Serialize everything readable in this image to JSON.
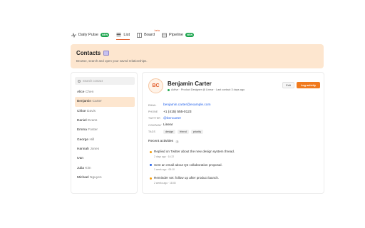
{
  "nav": {
    "tabs": [
      {
        "label": "Daily Pulse",
        "badge": "NEW"
      },
      {
        "label": "List"
      },
      {
        "label": "Board",
        "tag": "beta"
      },
      {
        "label": "Pipeline",
        "badge": "NEW"
      }
    ],
    "active_tab": "List"
  },
  "header": {
    "title": "Contacts",
    "subtitle": "Browse, search and open your saved relationships."
  },
  "search": {
    "placeholder": "Search contact"
  },
  "contacts": [
    {
      "first": "Alice",
      "last": "Chen"
    },
    {
      "first": "Benjamin",
      "last": "Carter"
    },
    {
      "first": "Chloe",
      "last": "Davis"
    },
    {
      "first": "Daniel",
      "last": "Evans"
    },
    {
      "first": "Emma",
      "last": "Foster"
    },
    {
      "first": "George",
      "last": "Hill"
    },
    {
      "first": "Hannah",
      "last": "Jones"
    },
    {
      "first": "Ivan",
      "last": ""
    },
    {
      "first": "Julia",
      "last": "Kim"
    },
    {
      "first": "Michael",
      "last": "Nguyen"
    }
  ],
  "selected_contact": "Benjamin Carter",
  "detail": {
    "initials": "BC",
    "name": "Benjamin Carter",
    "status": "Active",
    "role": "Product Designer @ Linear",
    "last_contact": "Last contact 3 days ago",
    "edit_label": "Edit",
    "log_label": "Log activity",
    "fields": {
      "email_label": "EMAIL",
      "email": "benjamin.carter@example.com",
      "phone_label": "PHONE",
      "phone": "+1 (415) 555-0123",
      "twitter_label": "TWITTER",
      "twitter": "@bencarter",
      "company_label": "COMPANY",
      "company": "Linear",
      "tags_label": "TAGS",
      "tags": [
        "design",
        "friend",
        "priority"
      ]
    },
    "activity_title": "Recent activities",
    "activity_count": "3",
    "activities": [
      {
        "text": "Replied on Twitter about the new design system thread.",
        "time": "2 days ago · 14:22",
        "color": "#f59e0b"
      },
      {
        "text": "Sent an email about Q2 collaboration proposal.",
        "time": "1 week ago · 09:10",
        "color": "#2563eb"
      },
      {
        "text": "Reminder set: follow up after product launch.",
        "time": "2 weeks ago · 18:45",
        "color": "#f59e0b"
      }
    ]
  },
  "colors": {
    "accent": "#f07a1e",
    "hero_bg": "#fde6cf",
    "badge_green": "#16a34a",
    "link_blue": "#2563eb"
  }
}
